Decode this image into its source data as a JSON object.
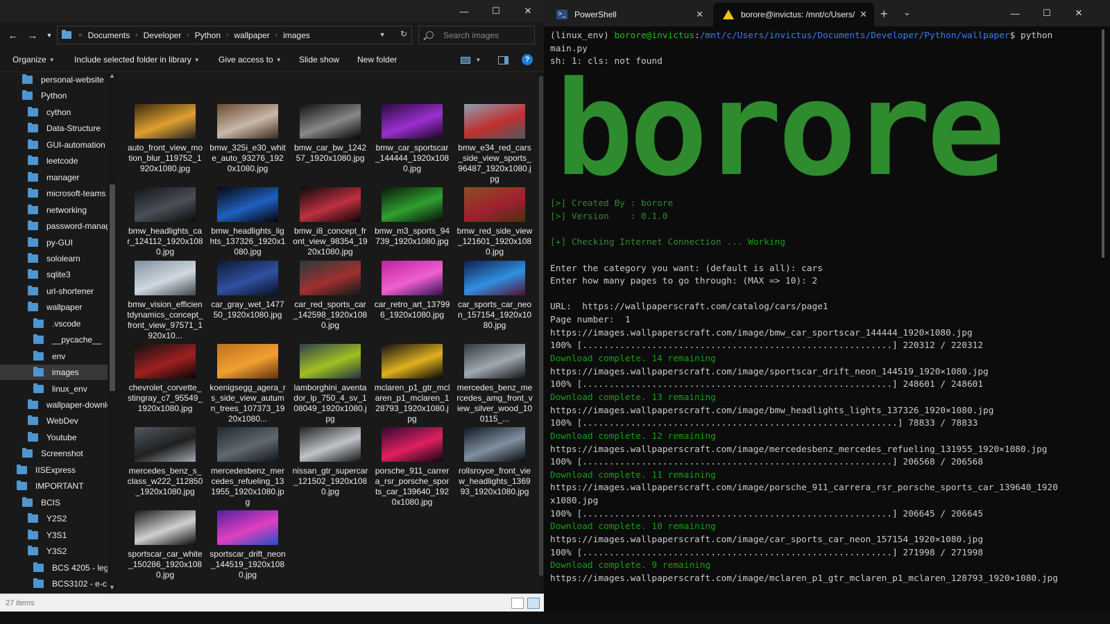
{
  "explorer": {
    "window_controls": [
      "—",
      "☐",
      "✕"
    ],
    "breadcrumb": [
      "Documents",
      "Developer",
      "Python",
      "wallpaper",
      "images"
    ],
    "search_placeholder": "Search images",
    "commands": {
      "organize": "Organize",
      "include_library": "Include selected folder in library",
      "give_access": "Give access to",
      "slide_show": "Slide show",
      "new_folder": "New folder"
    },
    "nav_items": [
      {
        "label": "personal-website",
        "indent": 2
      },
      {
        "label": "Python",
        "indent": 2
      },
      {
        "label": "cython",
        "indent": 3
      },
      {
        "label": "Data-Structure",
        "indent": 3
      },
      {
        "label": "GUI-automation",
        "indent": 3
      },
      {
        "label": "leetcode",
        "indent": 3
      },
      {
        "label": "manager",
        "indent": 3
      },
      {
        "label": "microsoft-teams",
        "indent": 3
      },
      {
        "label": "networking",
        "indent": 3
      },
      {
        "label": "password-manager",
        "indent": 3
      },
      {
        "label": "py-GUI",
        "indent": 3
      },
      {
        "label": "sololearn",
        "indent": 3
      },
      {
        "label": "sqlite3",
        "indent": 3
      },
      {
        "label": "url-shortener",
        "indent": 3
      },
      {
        "label": "wallpaper",
        "indent": 3
      },
      {
        "label": ".vscode",
        "indent": 4
      },
      {
        "label": "__pycache__",
        "indent": 4
      },
      {
        "label": "env",
        "indent": 4
      },
      {
        "label": "images",
        "indent": 4,
        "selected": true
      },
      {
        "label": "linux_env",
        "indent": 4
      },
      {
        "label": "wallpaper-downloader",
        "indent": 3
      },
      {
        "label": "WebDev",
        "indent": 3
      },
      {
        "label": "Youtube",
        "indent": 3
      },
      {
        "label": "Screenshot",
        "indent": 2
      },
      {
        "label": "IISExpress",
        "indent": 1
      },
      {
        "label": "IMPORTANT",
        "indent": 1
      },
      {
        "label": "BCIS",
        "indent": 2
      },
      {
        "label": "Y2S2",
        "indent": 3
      },
      {
        "label": "Y3S1",
        "indent": 3
      },
      {
        "label": "Y3S2",
        "indent": 3
      },
      {
        "label": "BCS 4205 - leg",
        "indent": 4
      },
      {
        "label": "BCS3102 - e-c",
        "indent": 4
      }
    ],
    "files": [
      {
        "name": "auto_front_view_motion_blur_119752_1920x1080.jpg",
        "colors": [
          "#3a2a10",
          "#e0a030",
          "#222"
        ]
      },
      {
        "name": "bmw_325i_e30_white_auto_93276_1920x1080.jpg",
        "colors": [
          "#6a4a30",
          "#c8b8a8",
          "#3a2a20"
        ]
      },
      {
        "name": "bmw_car_bw_124257_1920x1080.jpg",
        "colors": [
          "#111",
          "#888",
          "#050505"
        ]
      },
      {
        "name": "bmw_car_sportscar_144444_1920x1080.jpg",
        "colors": [
          "#2a0a40",
          "#9a30d0",
          "#1a0520"
        ]
      },
      {
        "name": "bmw_e34_red_cars_side_view_sports_96487_1920x1080.jpg",
        "colors": [
          "#8aa0b0",
          "#c03030",
          "#505860"
        ]
      },
      {
        "name": "bmw_headlights_car_124112_1920x1080.jpg",
        "colors": [
          "#101418",
          "#4a5058",
          "#0a0a0a"
        ]
      },
      {
        "name": "bmw_headlights_lights_137326_1920x1080.jpg",
        "colors": [
          "#05080f",
          "#2060c0",
          "#020305"
        ]
      },
      {
        "name": "bmw_i8_concept_front_view_98354_1920x1080.jpg",
        "colors": [
          "#0a0a0a",
          "#c03040",
          "#050505"
        ]
      },
      {
        "name": "bmw_m3_sports_94739_1920x1080.jpg",
        "colors": [
          "#0a1a0a",
          "#30a030",
          "#050a05"
        ]
      },
      {
        "name": "bmw_red_side_view_121601_1920x1080.jpg",
        "colors": [
          "#8a5020",
          "#a02030",
          "#4a3010"
        ]
      },
      {
        "name": "bmw_vision_efficientdynamics_concept_front_view_97571_1920x10...",
        "colors": [
          "#8090a0",
          "#d0d8e0",
          "#404850"
        ]
      },
      {
        "name": "car_gray_wet_147750_1920x1080.jpg",
        "colors": [
          "#0a1a30",
          "#3050a0",
          "#081020"
        ]
      },
      {
        "name": "car_red_sports_car_142598_1920x1080.jpg",
        "colors": [
          "#2a3a3a",
          "#a03030",
          "#101818"
        ]
      },
      {
        "name": "car_retro_art_137996_1920x1080.jpg",
        "colors": [
          "#c020a0",
          "#f060d0",
          "#301050"
        ]
      },
      {
        "name": "car_sports_car_neon_157154_1920x1080.jpg",
        "colors": [
          "#102050",
          "#3090e0",
          "#501030"
        ]
      },
      {
        "name": "chevrolet_corvette_stingray_c7_95549_1920x1080.jpg",
        "colors": [
          "#101010",
          "#a02020",
          "#050505"
        ]
      },
      {
        "name": "koenigsegg_agera_rs_side_view_autumn_trees_107373_1920x1080...",
        "colors": [
          "#c07020",
          "#f0a030",
          "#603010"
        ]
      },
      {
        "name": "lamborghini_aventador_lp_750_4_sv_108049_1920x1080.jpg",
        "colors": [
          "#304050",
          "#a0c020",
          "#203040"
        ]
      },
      {
        "name": "mclaren_p1_gtr_mclaren_p1_mclaren_128793_1920x1080.jpg",
        "colors": [
          "#101010",
          "#e0b020",
          "#050505"
        ]
      },
      {
        "name": "mercedes_benz_mercedes_amg_front_view_silver_wood_100115_...",
        "colors": [
          "#303840",
          "#a0a8b0",
          "#101418"
        ]
      },
      {
        "name": "mercedes_benz_s_class_w222_112850_1920x1080.jpg",
        "colors": [
          "#505860",
          "#202020",
          "#a0a8b0"
        ]
      },
      {
        "name": "mercedesbenz_mercedes_refueling_131955_1920x1080.jpg",
        "colors": [
          "#202830",
          "#606870",
          "#101418"
        ]
      },
      {
        "name": "nissan_gtr_supercar_121502_1920x1080.jpg",
        "colors": [
          "#202428",
          "#c0c4c8",
          "#101214"
        ]
      },
      {
        "name": "porsche_911_carrera_rsr_porsche_sports_car_139640_1920x1080.jpg",
        "colors": [
          "#300830",
          "#e02060",
          "#100410"
        ]
      },
      {
        "name": "rollsroyce_front_view_headlights_136993_1920x1080.jpg",
        "colors": [
          "#101820",
          "#8090a0",
          "#05080a"
        ]
      },
      {
        "name": "sportscar_car_white_150286_1920x1080.jpg",
        "colors": [
          "#181a1c",
          "#d0d0d0",
          "#0a0a0a"
        ]
      },
      {
        "name": "sportscar_drift_neon_144519_1920x1080.jpg",
        "colors": [
          "#5020a0",
          "#e040c0",
          "#2050c0"
        ]
      }
    ],
    "status": "27 items"
  },
  "terminal": {
    "tabs": [
      {
        "label": "PowerShell"
      },
      {
        "label": "borore@invictus: /mnt/c/Users/"
      }
    ],
    "window_controls": [
      "—",
      "☐",
      "✕"
    ],
    "banner": "borore",
    "lines": [
      [
        {
          "t": "(linux_env) ",
          "c": ""
        },
        {
          "t": "borore@invictus",
          "c": "gb"
        },
        {
          "t": ":",
          "c": ""
        },
        {
          "t": "/mnt/c/Users/invictus/Documents/Developer/Python/wallpaper",
          "c": "b"
        },
        {
          "t": "$ python",
          "c": ""
        }
      ],
      [
        {
          "t": "main.py",
          "c": ""
        }
      ],
      [
        {
          "t": "sh: 1: cls: not found",
          "c": ""
        }
      ],
      [],
      [],
      [],
      [],
      [],
      [],
      [],
      [],
      [],
      [],
      [
        {
          "t": "[>] Created By : borore",
          "c": "dg"
        }
      ],
      [
        {
          "t": "[>] Version    : 0.1.0",
          "c": "dg"
        }
      ],
      [],
      [
        {
          "t": "[+] Checking Internet Connection ... ",
          "c": "dg"
        },
        {
          "t": "Working",
          "c": "g"
        }
      ],
      [],
      [
        {
          "t": "Enter the category you want: (default is all): cars",
          "c": ""
        }
      ],
      [
        {
          "t": "Enter how many pages to go through: (MAX => 10): 2",
          "c": ""
        }
      ],
      [],
      [
        {
          "t": "URL:  https://wallpaperscraft.com/catalog/cars/page1",
          "c": ""
        }
      ],
      [
        {
          "t": "Page number:  1",
          "c": ""
        }
      ],
      [
        {
          "t": "https://images.wallpaperscraft.com/image/bmw_car_sportscar_144444_1920×1080.jpg",
          "c": ""
        }
      ],
      [
        {
          "t": "100% [..........................................................] 220312 / 220312",
          "c": ""
        }
      ],
      [
        {
          "t": "Download complete. 14 remaining",
          "c": "g"
        }
      ],
      [
        {
          "t": "https://images.wallpaperscraft.com/image/sportscar_drift_neon_144519_1920×1080.jpg",
          "c": ""
        }
      ],
      [
        {
          "t": "100% [..........................................................] 248601 / 248601",
          "c": ""
        }
      ],
      [
        {
          "t": "Download complete. 13 remaining",
          "c": "g"
        }
      ],
      [
        {
          "t": "https://images.wallpaperscraft.com/image/bmw_headlights_lights_137326_1920×1080.jpg",
          "c": ""
        }
      ],
      [
        {
          "t": "100% [...........................................................] 78833 / 78833",
          "c": ""
        }
      ],
      [
        {
          "t": "Download complete. 12 remaining",
          "c": "g"
        }
      ],
      [
        {
          "t": "https://images.wallpaperscraft.com/image/mercedesbenz_mercedes_refueling_131955_1920×1080.jpg",
          "c": ""
        }
      ],
      [
        {
          "t": "100% [..........................................................] 206568 / 206568",
          "c": ""
        }
      ],
      [
        {
          "t": "Download complete. 11 remaining",
          "c": "g"
        }
      ],
      [
        {
          "t": "https://images.wallpaperscraft.com/image/porsche_911_carrera_rsr_porsche_sports_car_139640_1920",
          "c": ""
        }
      ],
      [
        {
          "t": "x1080.jpg",
          "c": ""
        }
      ],
      [
        {
          "t": "100% [..........................................................] 206645 / 206645",
          "c": ""
        }
      ],
      [
        {
          "t": "Download complete. 10 remaining",
          "c": "g"
        }
      ],
      [
        {
          "t": "https://images.wallpaperscraft.com/image/car_sports_car_neon_157154_1920×1080.jpg",
          "c": ""
        }
      ],
      [
        {
          "t": "100% [..........................................................] 271998 / 271998",
          "c": ""
        }
      ],
      [
        {
          "t": "Download complete. 9 remaining",
          "c": "g"
        }
      ],
      [
        {
          "t": "https://images.wallpaperscraft.com/image/mclaren_p1_gtr_mclaren_p1_mclaren_128793_1920×1080.jpg",
          "c": ""
        }
      ]
    ]
  }
}
